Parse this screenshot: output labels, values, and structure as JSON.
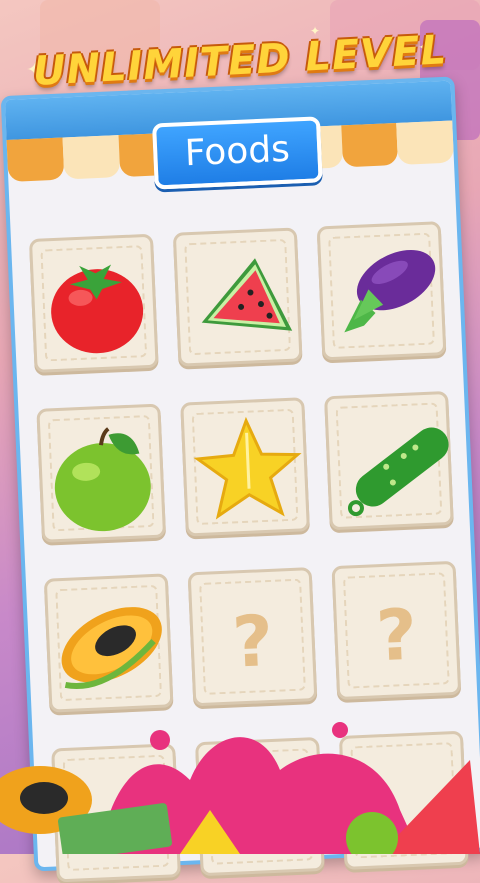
{
  "banner": {
    "text": "UNLIMITED LEVEL"
  },
  "panel": {
    "title": "Foods"
  },
  "cards": [
    {
      "item": "tomato",
      "locked": false
    },
    {
      "item": "watermelon",
      "locked": false
    },
    {
      "item": "eggplant",
      "locked": false
    },
    {
      "item": "green-apple",
      "locked": false
    },
    {
      "item": "starfruit",
      "locked": false
    },
    {
      "item": "cucumber",
      "locked": false
    },
    {
      "item": "papaya",
      "locked": false
    },
    {
      "item": "unknown",
      "locked": true,
      "label": "?"
    },
    {
      "item": "unknown",
      "locked": true,
      "label": "?"
    }
  ],
  "colors": {
    "banner_yellow": "#ffd43a",
    "panel_blue": "#3f96e0",
    "card_bg": "#f4ecde",
    "question_mark": "#e5bf8a"
  }
}
